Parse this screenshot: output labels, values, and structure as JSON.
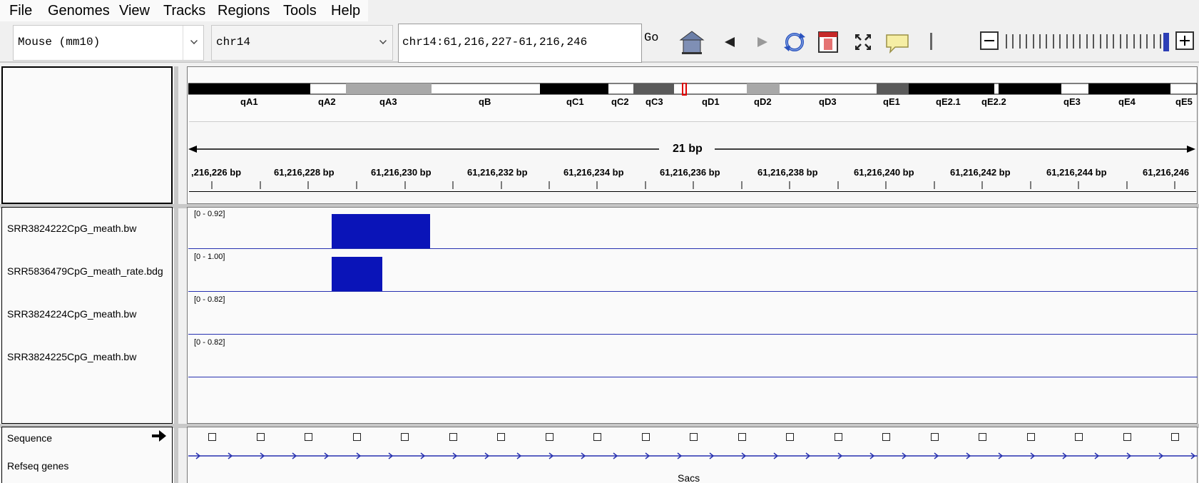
{
  "menu": [
    "File",
    "Genomes",
    "View",
    "Tracks",
    "Regions",
    "Tools",
    "Help"
  ],
  "toolbar": {
    "genome": "Mouse (mm10)",
    "chromosome": "chr14",
    "locus": "chr14:61,216,227-61,216,246",
    "go_label": "Go"
  },
  "ideogram": {
    "bands": [
      "qA1",
      "qA2",
      "qA3",
      "qB",
      "qC1",
      "qC2",
      "qC3",
      "qD1",
      "qD2",
      "qD3",
      "qE1",
      "qE2.1",
      "qE2.2",
      "qE3",
      "qE4",
      "qE5"
    ]
  },
  "ruler": {
    "span_label": "21 bp",
    "ticks": [
      ",216,226 bp",
      "61,216,228 bp",
      "61,216,230 bp",
      "61,216,232 bp",
      "61,216,234 bp",
      "61,216,236 bp",
      "61,216,238 bp",
      "61,216,240 bp",
      "61,216,242 bp",
      "61,216,244 bp",
      "61,216,246"
    ]
  },
  "tracks": [
    {
      "name": "SRR3824222CpG_meath.bw",
      "range": "[0 - 0.92]"
    },
    {
      "name": "SRR5836479CpG_meath_rate.bdg",
      "range": "[0 - 1.00]"
    },
    {
      "name": "SRR3824224CpG_meath.bw",
      "range": "[0 - 0.82]"
    },
    {
      "name": "SRR3824225CpG_meath.bw",
      "range": "[0 - 0.82]"
    }
  ],
  "bottom_tracks": {
    "sequence_label": "Sequence",
    "refseq_label": "Refseq genes",
    "gene_name": "Sacs"
  },
  "colors": {
    "data_bar": "#0a14b8",
    "track_line": "#2630b0",
    "zoom_thumb": "#2d3fb6"
  }
}
